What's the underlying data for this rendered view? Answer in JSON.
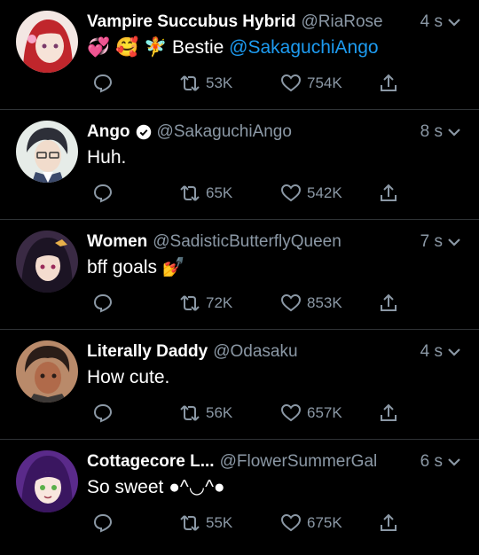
{
  "tweets": [
    {
      "name": "Vampire Succubus Hybrid",
      "handle": "@RiaRose",
      "time": "4 s",
      "text_prefix": "💞 🥰 🧚 Bestie ",
      "mention": "@SakaguchiAngo",
      "text_suffix": "",
      "retweets": "53K",
      "likes": "754K",
      "verified": false
    },
    {
      "name": "Ango",
      "handle": "@SakaguchiAngo",
      "time": "8 s",
      "text_prefix": "Huh.",
      "mention": "",
      "text_suffix": "",
      "retweets": "65K",
      "likes": "542K",
      "verified": true
    },
    {
      "name": "Women",
      "handle": "@SadisticButterflyQueen",
      "time": "7 s",
      "text_prefix": "bff goals 💅",
      "mention": "",
      "text_suffix": "",
      "retweets": "72K",
      "likes": "853K",
      "verified": false
    },
    {
      "name": "Literally Daddy",
      "handle": "@Odasaku",
      "time": "4 s",
      "text_prefix": "How cute.",
      "mention": "",
      "text_suffix": "",
      "retweets": "56K",
      "likes": "657K",
      "verified": false
    },
    {
      "name": "Cottagecore L...",
      "handle": "@FlowerSummerGal",
      "time": "6 s",
      "text_prefix": "So sweet ●^◡^●",
      "mention": "",
      "text_suffix": "",
      "retweets": "55K",
      "likes": "675K",
      "verified": false
    }
  ],
  "colors": {
    "background": "#000000",
    "text": "#ffffff",
    "secondary": "#8b98a5",
    "link": "#1d9bf0",
    "divider": "#2f3336"
  },
  "icons": [
    "reply-icon",
    "retweet-icon",
    "like-icon",
    "share-icon",
    "chevron-down-icon",
    "verified-icon"
  ]
}
